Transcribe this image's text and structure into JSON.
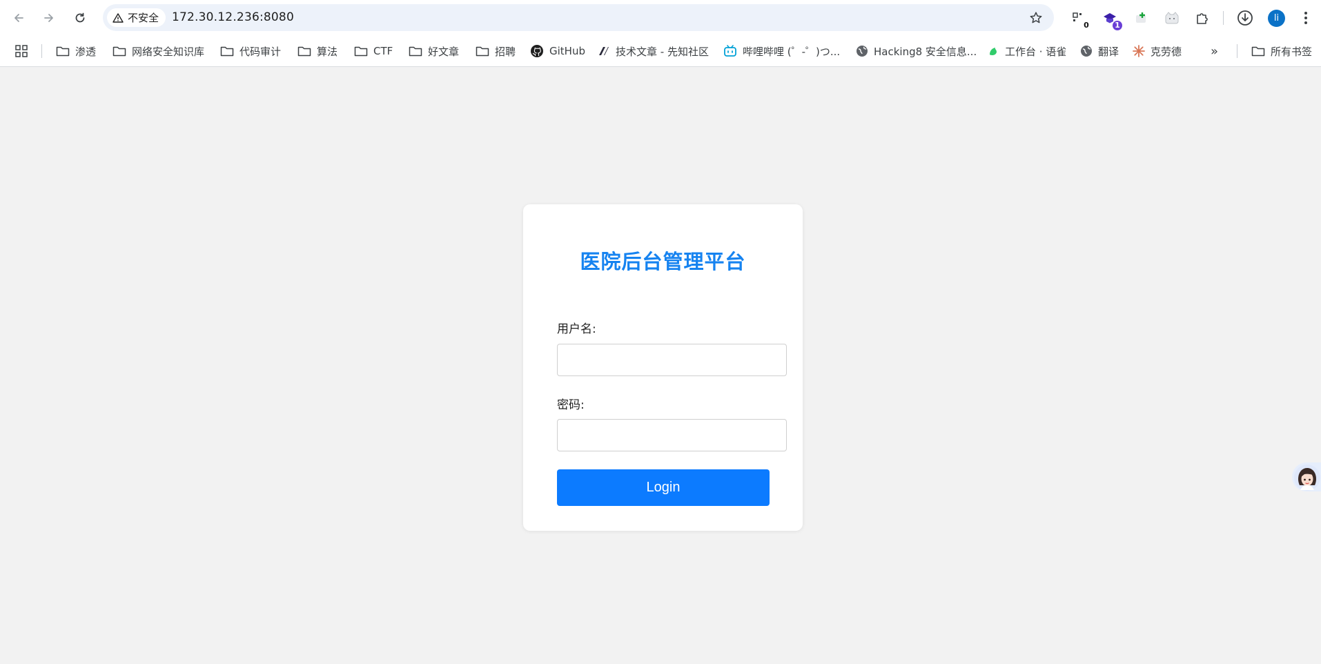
{
  "browser": {
    "security_label": "不安全",
    "url": "172.30.12.236:8080",
    "extensions": [
      {
        "name": "ext-1",
        "badge": "0"
      },
      {
        "name": "ext-2",
        "badge": "1"
      }
    ],
    "profile_initial": "li"
  },
  "bookmarks": {
    "items": [
      {
        "label": "渗透",
        "icon": "folder-icon"
      },
      {
        "label": "网络安全知识库",
        "icon": "folder-icon"
      },
      {
        "label": "代码审计",
        "icon": "folder-icon"
      },
      {
        "label": "算法",
        "icon": "folder-icon"
      },
      {
        "label": "CTF",
        "icon": "folder-icon"
      },
      {
        "label": "好文章",
        "icon": "folder-icon"
      },
      {
        "label": "招聘",
        "icon": "folder-icon"
      },
      {
        "label": "GitHub",
        "icon": "github-icon"
      },
      {
        "label": "技术文章 - 先知社区",
        "icon": "xianzhi-icon"
      },
      {
        "label": "哔哩哔哩 (゜-゜)つ...",
        "icon": "bilibili-icon"
      },
      {
        "label": "Hacking8 安全信息...",
        "icon": "globe-icon"
      },
      {
        "label": "工作台 · 语雀",
        "icon": "yuque-icon"
      },
      {
        "label": "翻译",
        "icon": "globe-icon"
      },
      {
        "label": "克劳德",
        "icon": "claude-icon"
      }
    ],
    "more_label": "»",
    "all_bookmarks_label": "所有书签"
  },
  "login": {
    "title": "医院后台管理平台",
    "username_label": "用户名:",
    "username_value": "",
    "password_label": "密码:",
    "password_value": "",
    "submit_label": "Login"
  },
  "colors": {
    "accent": "#1683f0",
    "button": "#0c7bff",
    "page_bg": "#f2f2f2"
  }
}
